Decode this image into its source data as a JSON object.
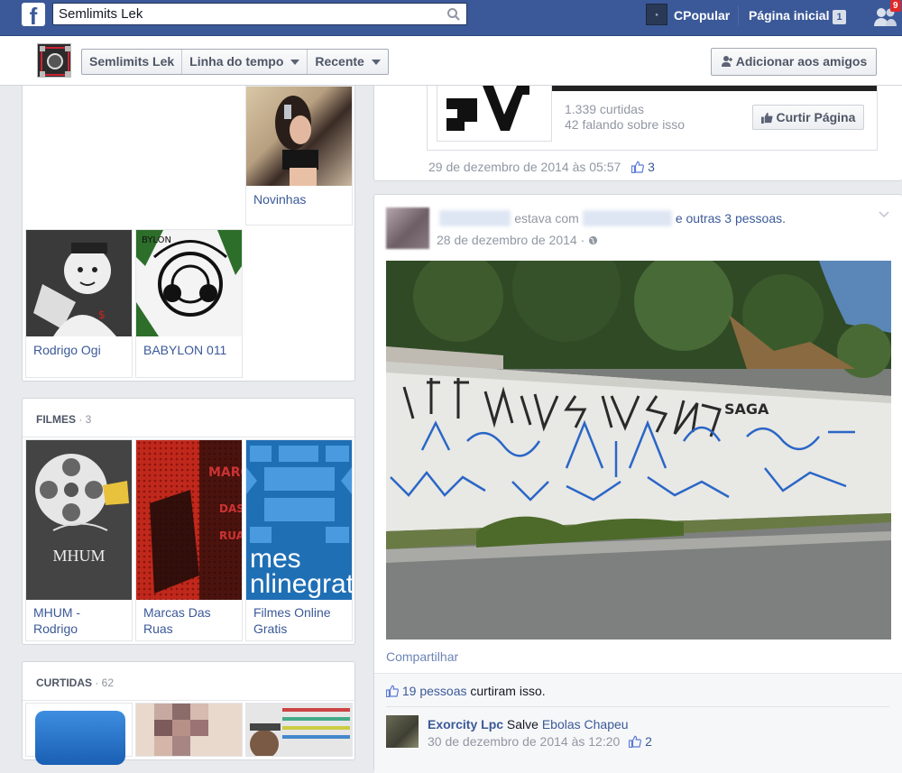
{
  "topbar": {
    "logo": "f",
    "search_value": "Semlimits Lek",
    "search_icon": "search-icon",
    "profile_name": "CPopular",
    "home_label": "Página inicial",
    "home_count": "1",
    "friend_requests_count": "9"
  },
  "subheader": {
    "page_name": "Semlimits Lek",
    "timeline_label": "Linha do tempo",
    "recent_label": "Recente",
    "add_friend_label": "Adicionar aos amigos"
  },
  "left": {
    "top_tiles": [
      {
        "caption": "Novinhas"
      },
      {
        "caption": "Rodrigo Ogi"
      },
      {
        "caption": "BABYLON 011"
      }
    ],
    "films": {
      "title": "FILMES",
      "count": "· 3",
      "tiles": [
        {
          "caption_line1": "MHUM -",
          "caption_line2": "Rodrigo",
          "logo_text": "MHUM"
        },
        {
          "caption_line1": "Marcas Das",
          "caption_line2": "Ruas"
        },
        {
          "caption_line1": "Filmes Online",
          "caption_line2": "Gratis",
          "art_line1": "mes",
          "art_line2": "nlinegrat"
        }
      ]
    },
    "likes": {
      "title": "CURTIDAS",
      "count": "· 62"
    }
  },
  "post1": {
    "likes_count": "1.339 curtidas",
    "talking": "42 falando sobre isso",
    "like_page_label": "Curtir Página",
    "timestamp": "29 de dezembro de 2014 às 05:57",
    "like_count": "3"
  },
  "post2": {
    "author_blur": "████████",
    "with_text": "estava com",
    "tagged_blur": "██████████",
    "others": "e outras 3 pessoas.",
    "timestamp": "28 de dezembro de 2014",
    "separator": "·",
    "share_label": "Compartilhar",
    "likes_people": "19 pessoas",
    "likes_suffix": "curtiram isso.",
    "wall_text": "SAGA",
    "comment": {
      "author": "Exorcity Lpc",
      "text": "Salve",
      "tag": "Ebolas Chapeu",
      "timestamp": "30 de dezembro de 2014 às 12:20",
      "like_count": "2"
    }
  },
  "colors": {
    "brand": "#3b5998",
    "background": "#e9eaed",
    "link": "#3b5998",
    "meta": "#9197a3"
  }
}
